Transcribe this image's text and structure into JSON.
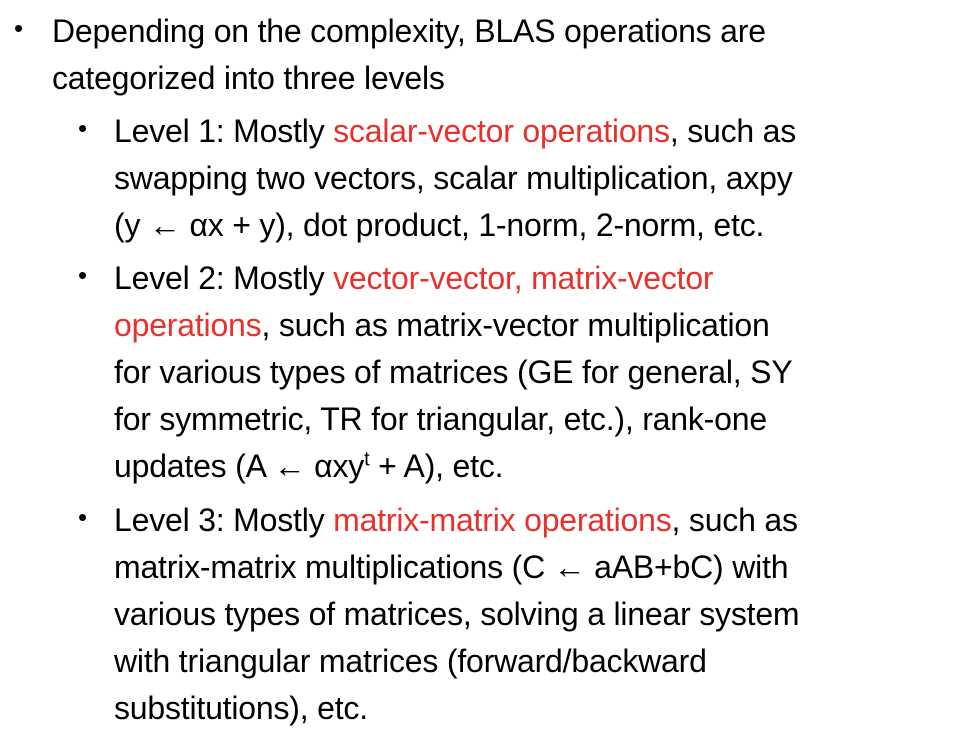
{
  "bullets": {
    "top": {
      "line1": "Depending on the complexity, BLAS operations are",
      "line2": "categorized into three levels"
    },
    "level1": {
      "pre": "Level 1: Mostly ",
      "highlight": "scalar-vector operations",
      "post": ", such as",
      "line2": "swapping two vectors, scalar multiplication, axpy",
      "line3": "(y ← αx + y), dot product, 1-norm, 2-norm, etc."
    },
    "level2": {
      "pre": "Level 2: Mostly ",
      "highlight1": "vector-vector, matrix-vector",
      "highlight2": "operations",
      "post2": ", such as matrix-vector multiplication",
      "line3": "for various types of matrices (GE for general, SY",
      "line4": "for symmetric, TR for triangular, etc.), rank-one",
      "line5_pre": "updates (A ← αxy",
      "line5_sup": "t",
      "line5_post": " + A), etc."
    },
    "level3": {
      "pre": "Level 3: Mostly ",
      "highlight": "matrix-matrix operations",
      "post": ", such as",
      "line2": "matrix-matrix multiplications (C ← aAB+bC) with",
      "line3": "various types of matrices, solving a linear system",
      "line4": "with triangular matrices (forward/backward",
      "line5": "substitutions), etc."
    }
  },
  "colors": {
    "highlight": "#e8312c",
    "text": "#000000"
  }
}
